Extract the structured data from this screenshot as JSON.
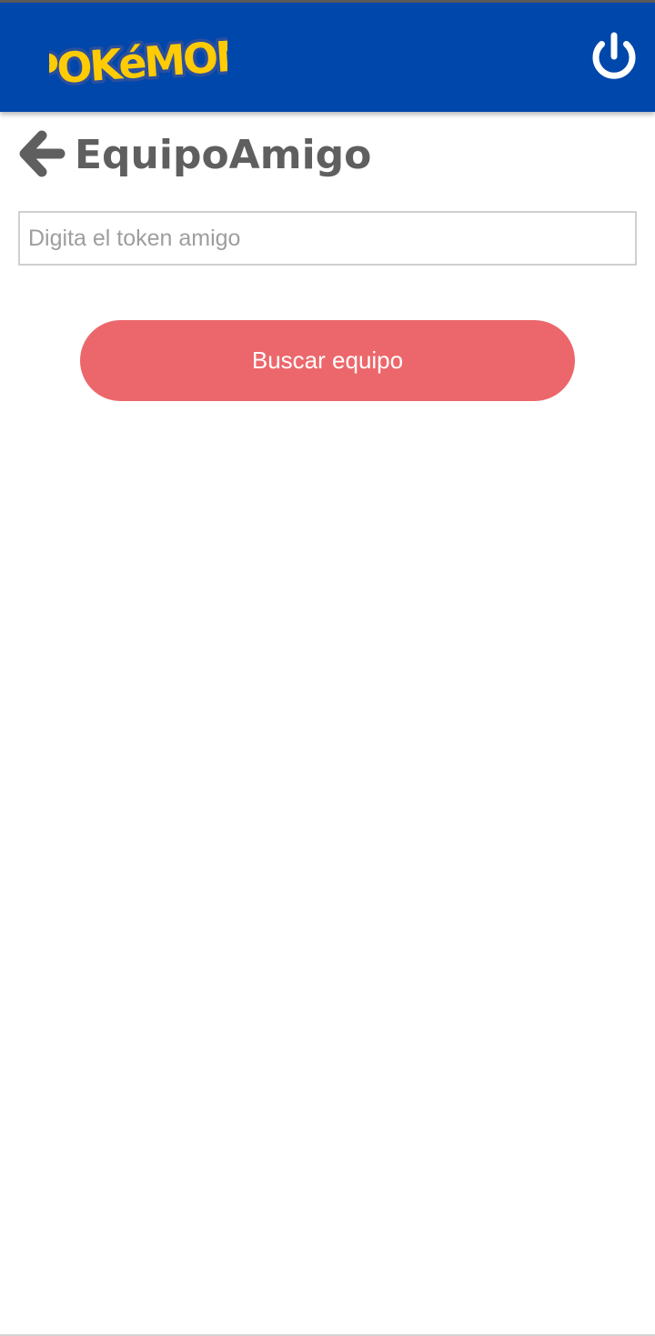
{
  "header": {
    "logo": {
      "text": "POKéMON",
      "icon": "pokemon-logo",
      "fill_color": "#FFCB05",
      "outline_color": "#2A4F9D"
    },
    "power_icon": "power-icon",
    "background_color": "#0047AB"
  },
  "title_bar": {
    "back_icon": "arrow-left-icon",
    "title": "EquipoAmigo"
  },
  "token_input": {
    "value": "",
    "placeholder": "Digita el token amigo"
  },
  "search_button": {
    "label": "Buscar equipo",
    "color": "#EC676B"
  }
}
